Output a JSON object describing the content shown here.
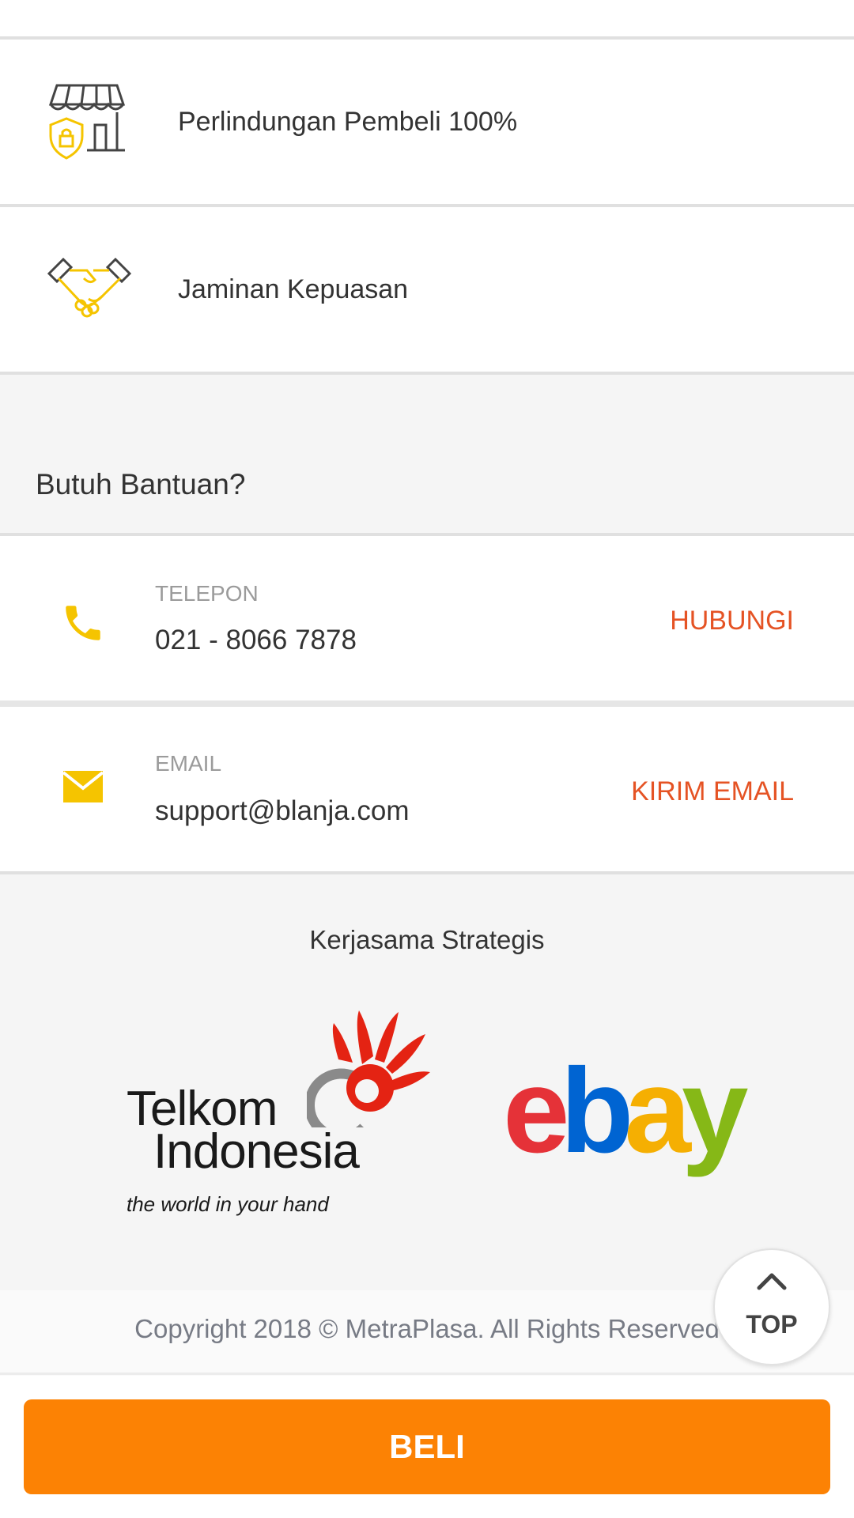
{
  "features": [
    {
      "icon": "store-shield-icon",
      "label": "Perlindungan Pembeli 100%"
    },
    {
      "icon": "handshake-icon",
      "label": "Jaminan Kepuasan"
    }
  ],
  "help": {
    "title": "Butuh Bantuan?",
    "phone": {
      "icon": "phone-icon",
      "label": "TELEPON",
      "value": "021 - 8066 7878",
      "action": "HUBUNGI"
    },
    "email": {
      "icon": "mail-icon",
      "label": "EMAIL",
      "value": "support@blanja.com",
      "action": "KIRIM EMAIL"
    }
  },
  "partners": {
    "title": "Kerjasama Strategis",
    "telkom": {
      "line1": "Telkom",
      "line2": "Indonesia",
      "tagline": "the world in your hand"
    },
    "ebay": {
      "letters": [
        "e",
        "b",
        "a",
        "y"
      ]
    }
  },
  "footer": {
    "copyright": "Copyright 2018 © MetraPlasa. All Rights Reserved"
  },
  "top_button": {
    "label": "TOP"
  },
  "buy_button": {
    "label": "BELI"
  },
  "colors": {
    "accent_orange": "#fc8204",
    "action_red": "#e55324",
    "icon_yellow": "#f5c400",
    "ebay_red": "#e53238",
    "ebay_blue": "#0064d2",
    "ebay_yellow": "#f5af02",
    "ebay_green": "#86b817",
    "telkom_red": "#e42313"
  }
}
